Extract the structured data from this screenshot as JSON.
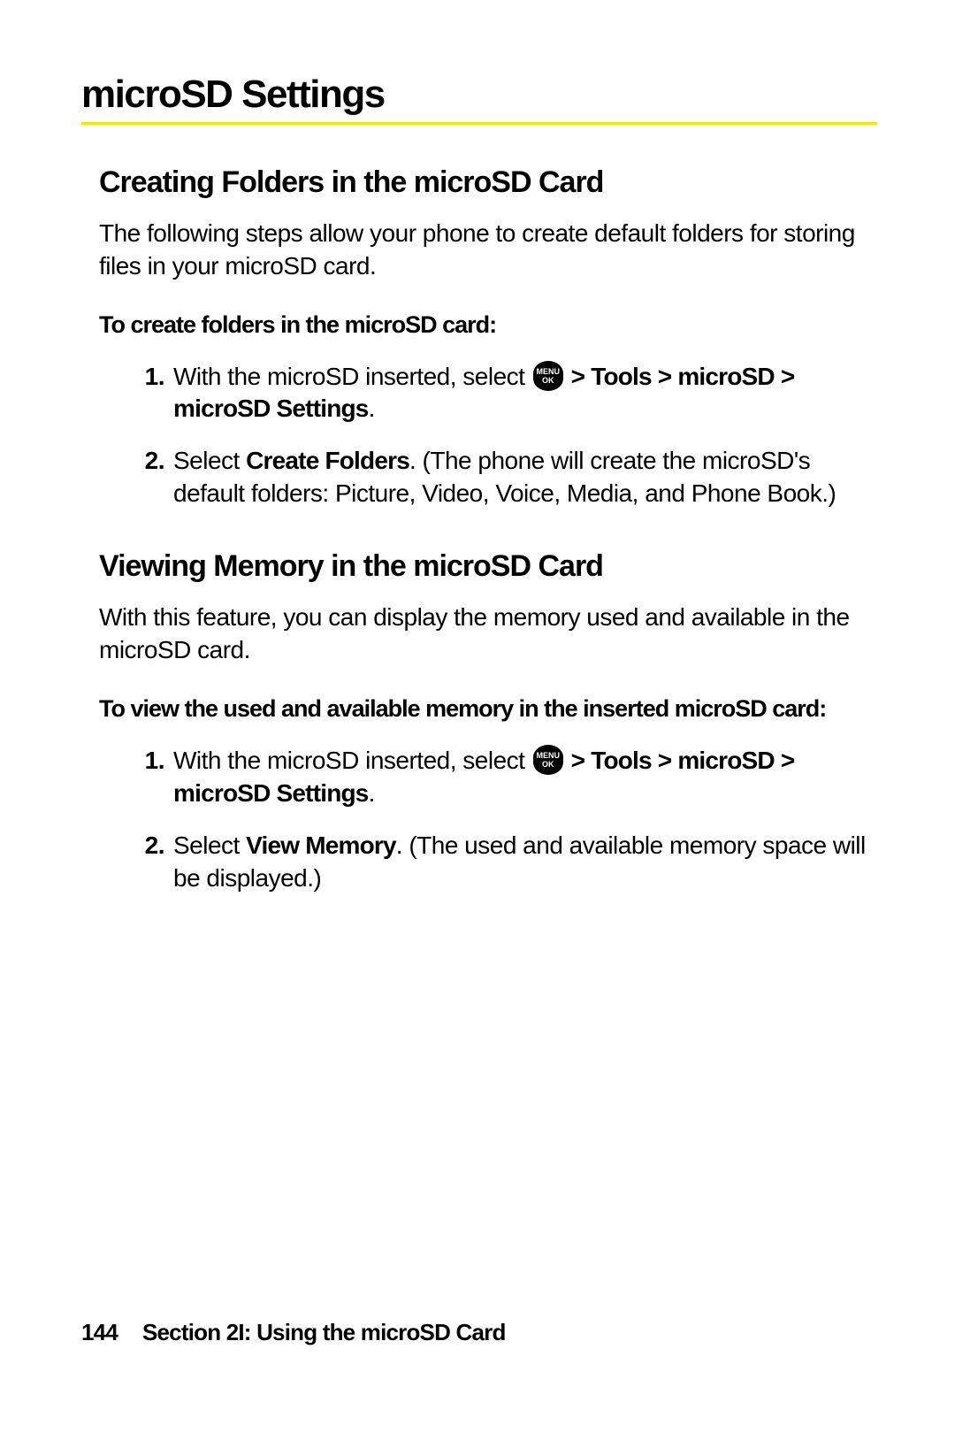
{
  "page_title": "microSD Settings",
  "section1": {
    "heading": "Creating Folders in the microSD Card",
    "intro": "The following steps allow your phone to create default folders for storing files in your microSD card.",
    "instruction_label": "To create folders in the microSD card:",
    "steps": {
      "s1_num": "1.",
      "s1_pre": "With the microSD inserted, select ",
      "s1_menu_top": "MENU",
      "s1_menu_bot": "OK",
      "s1_sep": " > ",
      "s1_path1": "Tools > microSD > microSD Settings",
      "s1_end": ".",
      "s2_num": "2.",
      "s2_pre": "Select ",
      "s2_bold": "Create Folders",
      "s2_post": ". (The phone will create the microSD's default folders: Picture, Video, Voice, Media, and Phone Book.)"
    }
  },
  "section2": {
    "heading": "Viewing Memory in the microSD Card",
    "intro": "With this feature, you can display the memory used and available in the microSD card.",
    "instruction_label": "To view the used and available memory in the inserted microSD card:",
    "steps": {
      "s1_num": "1.",
      "s1_pre": "With the microSD inserted, select ",
      "s1_menu_top": "MENU",
      "s1_menu_bot": "OK",
      "s1_sep": " > ",
      "s1_path1": "Tools > microSD > microSD Settings",
      "s1_end": ".",
      "s2_num": "2.",
      "s2_pre": "Select ",
      "s2_bold": "View Memory",
      "s2_post": ". (The used and available memory space will be displayed.)"
    }
  },
  "footer": {
    "page_num": "144",
    "section_label": "Section 2I: Using the microSD Card"
  }
}
